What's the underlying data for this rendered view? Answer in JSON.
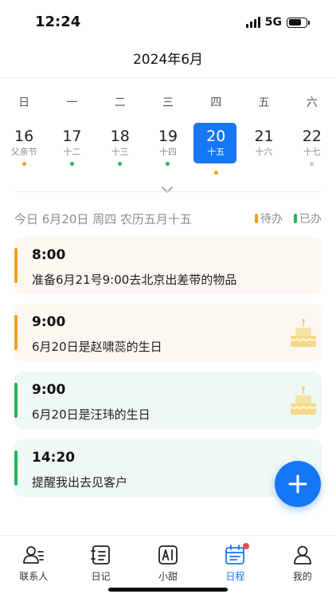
{
  "status": {
    "time": "12:24",
    "network": "5G"
  },
  "header": {
    "title": "2024年6月"
  },
  "weekdays": [
    "日",
    "一",
    "二",
    "三",
    "四",
    "五",
    "六"
  ],
  "dates": [
    {
      "day": "16",
      "lunar": "父亲节",
      "dot_color": "#f0a020"
    },
    {
      "day": "17",
      "lunar": "十二",
      "dot_color": "#22b45a"
    },
    {
      "day": "18",
      "lunar": "十三",
      "dot_color": "#22b45a"
    },
    {
      "day": "19",
      "lunar": "十四",
      "dot_color": "#22b45a"
    },
    {
      "day": "20",
      "lunar": "十五",
      "dot_color": "#f0a020",
      "selected": true
    },
    {
      "day": "21",
      "lunar": "十六",
      "dot_color": ""
    },
    {
      "day": "22",
      "lunar": "十七",
      "dot_color": "#c8c8c8"
    }
  ],
  "info": {
    "summary": "今日   6月20日 周四   农历五月十五"
  },
  "legend": {
    "pending_label": "待办",
    "done_label": "已办",
    "pending_color": "#f0a020",
    "done_color": "#22b45a"
  },
  "schedule": [
    {
      "time": "8:00",
      "text": "准备6月21号9:00去北京出差带的物品",
      "status": "pending",
      "icon": ""
    },
    {
      "time": "9:00",
      "text": "6月20日是赵啸蕊的生日",
      "status": "pending",
      "icon": "birthday-cake-icon"
    },
    {
      "time": "9:00",
      "text": "6月20日是汪玮的生日",
      "status": "done",
      "icon": "birthday-cake-icon"
    },
    {
      "time": "14:20",
      "text": "提醒我出去见客户",
      "status": "done",
      "icon": ""
    }
  ],
  "tabs": [
    {
      "label": "联系人",
      "icon": "contacts-icon"
    },
    {
      "label": "日记",
      "icon": "diary-icon"
    },
    {
      "label": "小甜",
      "icon": "ai-icon"
    },
    {
      "label": "日程",
      "icon": "calendar-icon",
      "active": true
    },
    {
      "label": "我的",
      "icon": "profile-icon"
    }
  ],
  "colors": {
    "accent": "#1677f5",
    "badge": "#f5455c"
  }
}
